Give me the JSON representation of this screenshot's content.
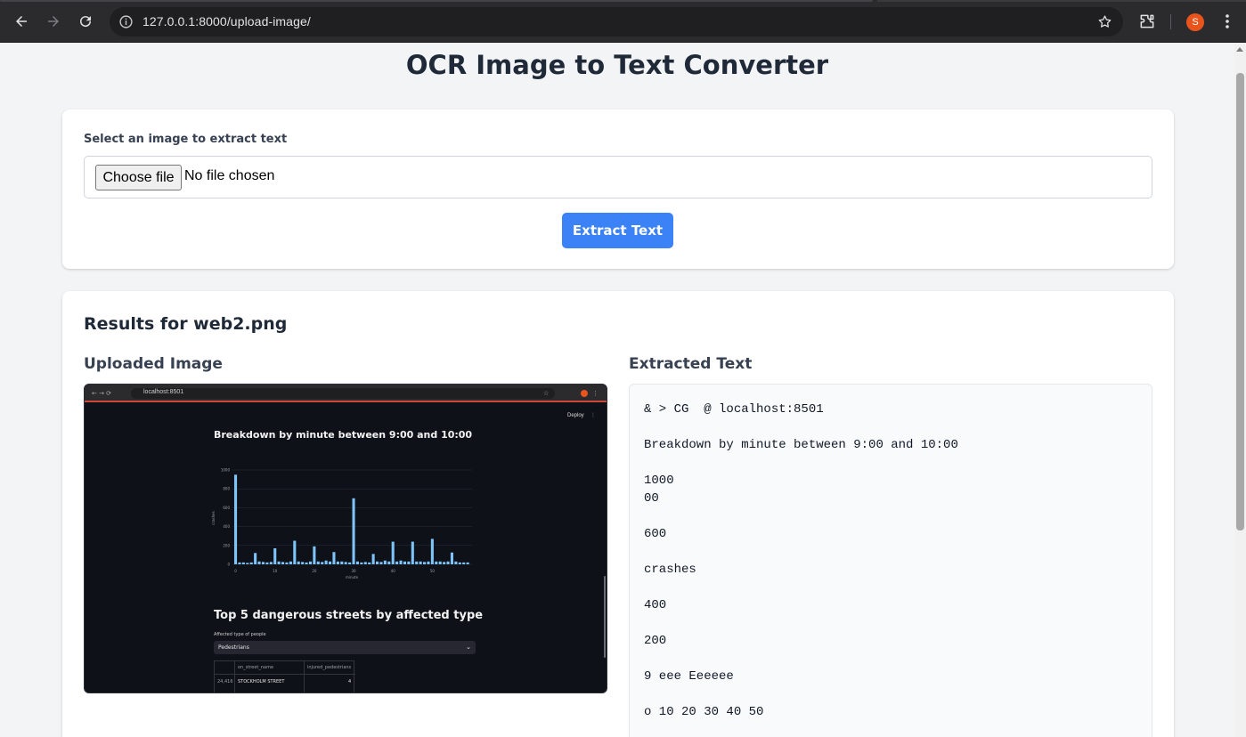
{
  "browser": {
    "url": "127.0.0.1:8000/upload-image/",
    "icons": {
      "back": "arrow-left-icon",
      "forward": "arrow-right-icon",
      "reload": "reload-icon",
      "site_info": "info-icon",
      "bookmark": "star-icon",
      "extensions": "puzzle-icon",
      "menu": "kebab-menu-icon"
    },
    "profile_initial": "S",
    "profile_color": "#e8541c"
  },
  "page": {
    "title": "OCR Image to Text Converter"
  },
  "upload_form": {
    "label": "Select an image to extract text",
    "choose_button": "Choose file",
    "file_status": "No file chosen",
    "submit_label": "Extract Text",
    "accent_color": "#3b82f6"
  },
  "results": {
    "heading": "Results for web2.png",
    "uploaded_image_title": "Uploaded Image",
    "extracted_text_title": "Extracted Text",
    "extracted_text": "& > CG  @ localhost:8501\n\nBreakdown by minute between 9:00 and 10:00\n\n1000\n00\n\n600\n\ncrashes\n\n400\n\n200\n\n9 eee Eeeeee\n\no 10 20 30 40 50",
    "screenshot": {
      "url": "localhost:8501",
      "deploy_label": "Deploy",
      "chart_title": "Breakdown by minute between 9:00 and 10:00",
      "y_label": "crashes",
      "x_label": "minute",
      "y_ticks": [
        "0",
        "200",
        "400",
        "600",
        "800",
        "1000"
      ],
      "x_ticks": [
        "0",
        "10",
        "20",
        "30",
        "40",
        "50"
      ],
      "minute_counts": [
        950,
        20,
        20,
        15,
        20,
        120,
        30,
        25,
        20,
        25,
        170,
        30,
        25,
        20,
        30,
        250,
        30,
        25,
        20,
        30,
        190,
        30,
        25,
        40,
        30,
        130,
        30,
        30,
        25,
        20,
        700,
        30,
        20,
        25,
        20,
        110,
        30,
        25,
        40,
        30,
        240,
        30,
        40,
        30,
        30,
        240,
        30,
        30,
        25,
        30,
        270,
        30,
        30,
        25,
        30,
        125,
        30,
        20,
        20,
        20
      ],
      "bar_color": "#7cc4fa",
      "section_title": "Top 5 dangerous streets by affected type",
      "select_label": "Affected type of people",
      "select_value": "Pedestrians",
      "table_headers": [
        "on_street_name",
        "injured_pedestrians"
      ],
      "table_row": [
        "24,416",
        "STOCKHOLM STREET",
        "4"
      ]
    }
  }
}
